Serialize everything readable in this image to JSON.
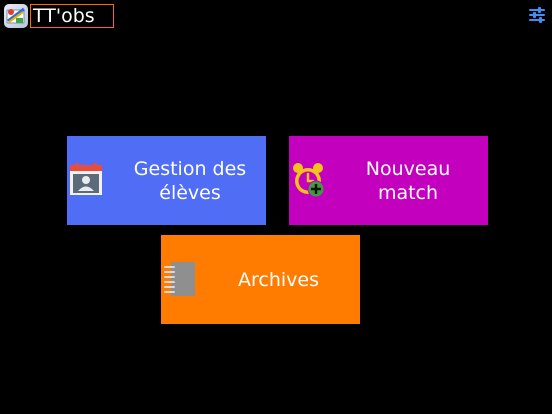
{
  "header": {
    "app_title": "TT'obs",
    "app_icon": "app-logo-icon",
    "settings_icon": "sliders-icon"
  },
  "tiles": {
    "students": {
      "label": "Gestion des élèves",
      "icon": "student-card-icon",
      "color": "#4f6ef5"
    },
    "match": {
      "label": "Nouveau match",
      "icon": "alarm-clock-add-icon",
      "color": "#c400bf"
    },
    "archives": {
      "label": "Archives",
      "icon": "notebook-icon",
      "color": "#ff7c00"
    }
  },
  "colors": {
    "background": "#000000",
    "title_border": "#ff6a00",
    "accent": "#4f6ef5"
  }
}
